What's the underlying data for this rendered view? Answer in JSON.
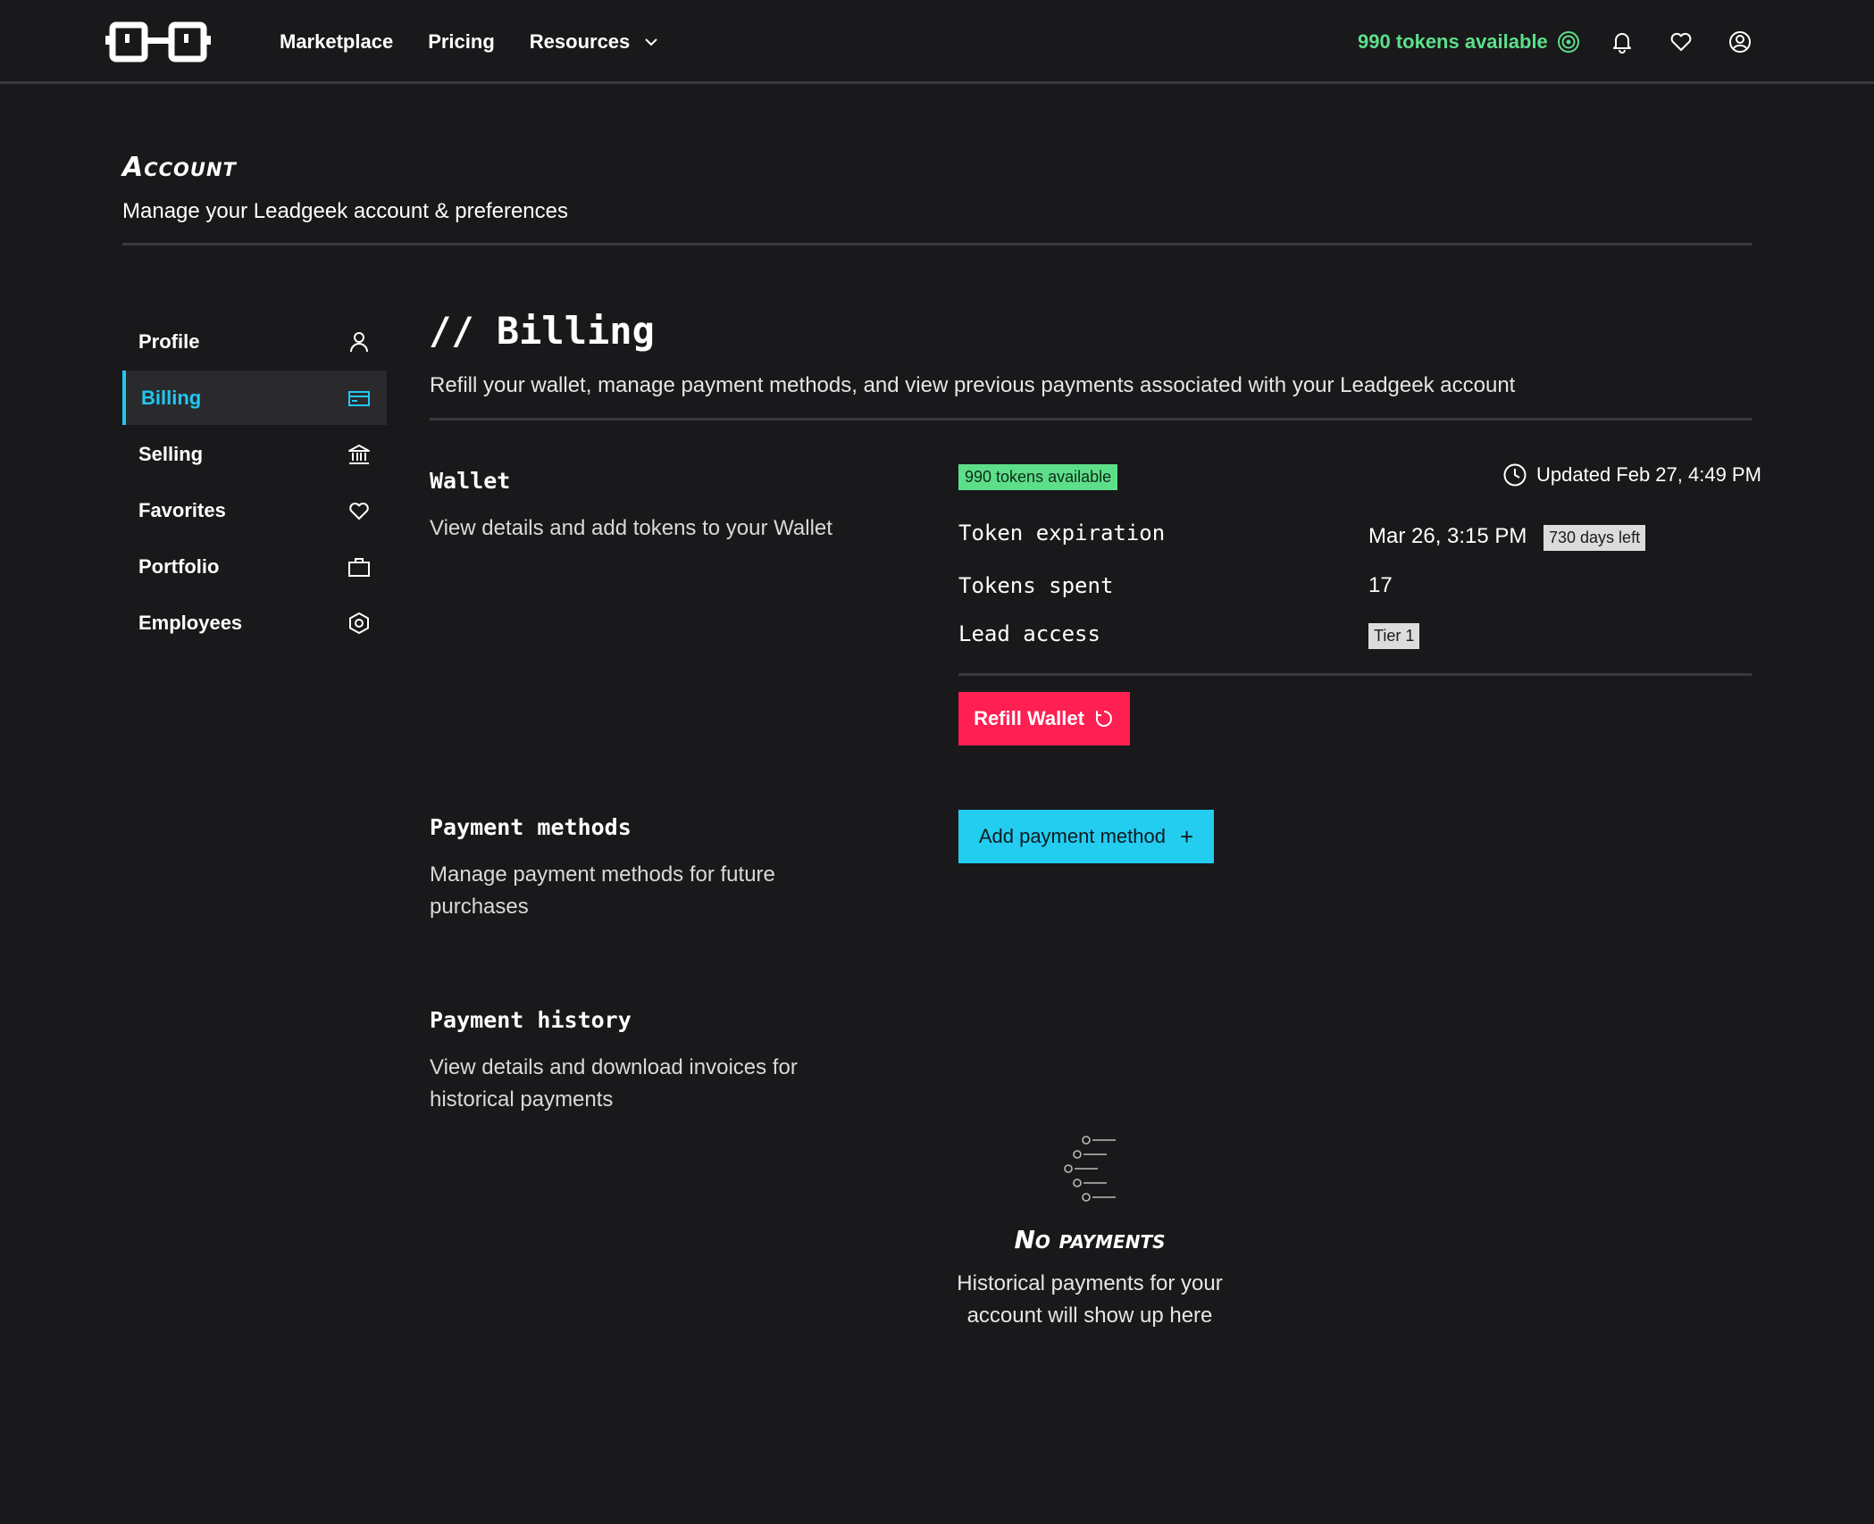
{
  "nav": {
    "links": [
      "Marketplace",
      "Pricing",
      "Resources"
    ],
    "tokens": "990 tokens available"
  },
  "header": {
    "title": "Account",
    "subtitle": "Manage your Leadgeek account & preferences"
  },
  "sidebar": {
    "items": [
      {
        "label": "Profile",
        "icon": "user-icon"
      },
      {
        "label": "Billing",
        "icon": "credit-card-icon"
      },
      {
        "label": "Selling",
        "icon": "bank-icon"
      },
      {
        "label": "Favorites",
        "icon": "heart-icon"
      },
      {
        "label": "Portfolio",
        "icon": "briefcase-icon"
      },
      {
        "label": "Employees",
        "icon": "hexagon-icon"
      }
    ],
    "active": "Billing"
  },
  "billing": {
    "heading": "// Billing",
    "description": "Refill your wallet, manage payment methods, and view previous payments associated with your Leadgeek account"
  },
  "wallet": {
    "title": "Wallet",
    "description": "View details and add tokens to your Wallet",
    "tokens_badge": "990 tokens available",
    "updated": "Updated Feb 27, 4:49 PM",
    "token_expiration_label": "Token expiration",
    "token_expiration_value": "Mar 26, 3:15 PM",
    "days_left": "730 days left",
    "tokens_spent_label": "Tokens spent",
    "tokens_spent_value": "17",
    "lead_access_label": "Lead access",
    "lead_access_value": "Tier 1",
    "refill_label": "Refill Wallet"
  },
  "payment_methods": {
    "title": "Payment methods",
    "description": "Manage payment methods for future purchases",
    "add_label": "Add payment method"
  },
  "payment_history": {
    "title": "Payment history",
    "description": "View details and download invoices for historical payments",
    "empty_title": "No payments",
    "empty_desc": "Historical payments for your account will show up here"
  },
  "colors": {
    "background": "#19191b",
    "accent_cyan": "#22cdf0",
    "accent_green": "#5ddf8a",
    "accent_red": "#ff1f52"
  }
}
